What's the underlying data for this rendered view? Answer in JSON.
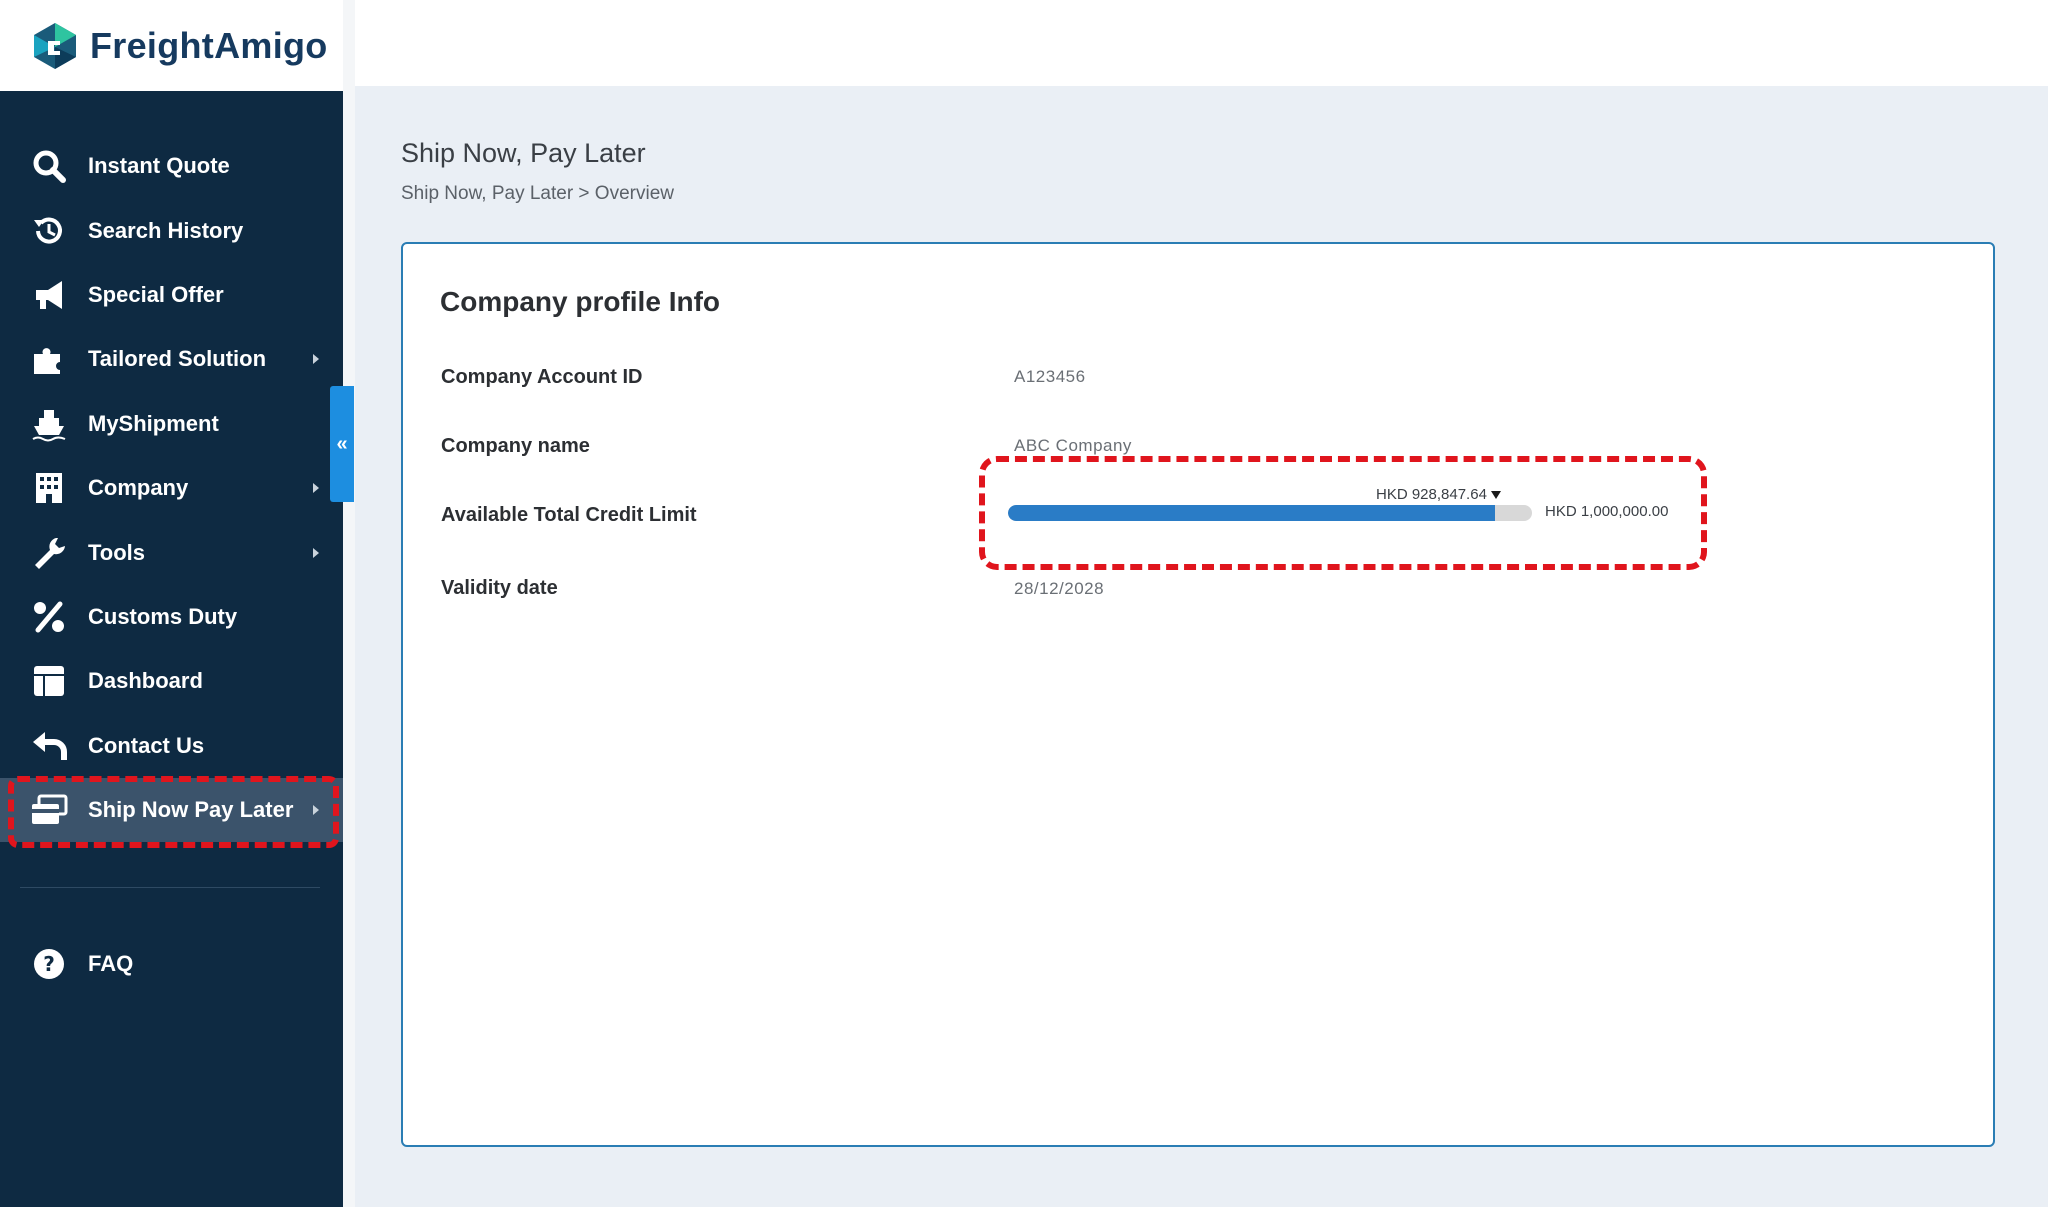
{
  "app": {
    "brand": "FreightAmigo"
  },
  "sidebar": {
    "items": [
      {
        "label": "Instant Quote",
        "icon": "search-icon",
        "arrow": false
      },
      {
        "label": "Search History",
        "icon": "history-icon",
        "arrow": false
      },
      {
        "label": "Special Offer",
        "icon": "megaphone-icon",
        "arrow": false
      },
      {
        "label": "Tailored Solution",
        "icon": "puzzle-icon",
        "arrow": true
      },
      {
        "label": "MyShipment",
        "icon": "ship-icon",
        "arrow": false
      },
      {
        "label": "Company",
        "icon": "building-icon",
        "arrow": true
      },
      {
        "label": "Tools",
        "icon": "wrench-icon",
        "arrow": true
      },
      {
        "label": "Customs Duty",
        "icon": "percent-icon",
        "arrow": false
      },
      {
        "label": "Dashboard",
        "icon": "dashboard-icon",
        "arrow": false
      },
      {
        "label": "Contact Us",
        "icon": "reply-icon",
        "arrow": false
      },
      {
        "label": "Ship Now Pay Later",
        "icon": "credit-card-icon",
        "arrow": true,
        "active": true
      }
    ],
    "faq": {
      "label": "FAQ",
      "icon": "question-icon"
    }
  },
  "page": {
    "title": "Ship Now, Pay Later",
    "breadcrumb": "Ship Now, Pay Later > Overview"
  },
  "card": {
    "title": "Company profile Info",
    "rows": {
      "account_id": {
        "label": "Company Account ID",
        "value": "A123456"
      },
      "company_name": {
        "label": "Company name",
        "value": "ABC Company"
      },
      "credit_limit": {
        "label": "Available Total Credit Limit"
      },
      "validity": {
        "label": "Validity date",
        "value": "28/12/2028"
      }
    },
    "credit": {
      "available_label": "HKD 928,847.64",
      "total_label": "HKD 1,000,000.00",
      "available": 928847.64,
      "total": 1000000.0
    }
  },
  "colors": {
    "sidebar_bg": "#0e2a42",
    "active_bg": "#3b536b",
    "accent": "#2a7cc6",
    "highlight": "#e0151d"
  }
}
